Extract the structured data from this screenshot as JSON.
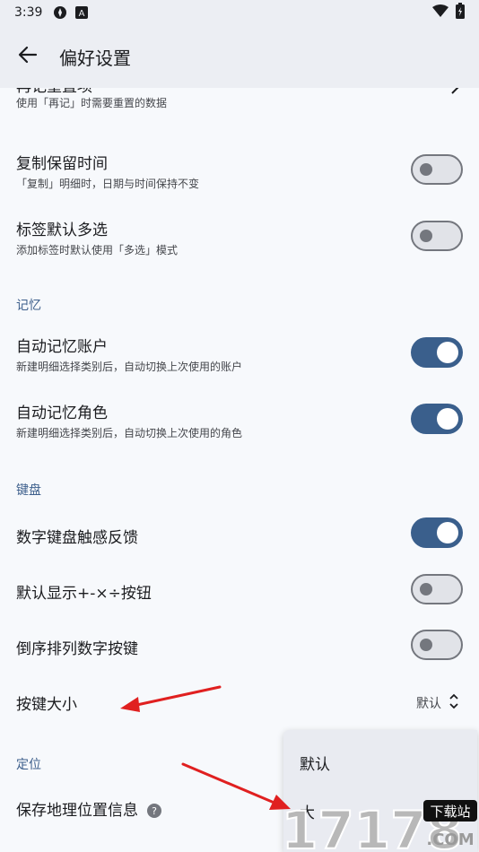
{
  "status_bar": {
    "time": "3:39"
  },
  "app_bar": {
    "title": "偏好设置"
  },
  "rows": {
    "reset_items": {
      "title": "再记重置项",
      "subtitle": "使用「再记」时需要重置的数据"
    },
    "copy_keep_time": {
      "title": "复制保留时间",
      "subtitle": "「复制」明细时，日期与时间保持不变",
      "on": false
    },
    "tag_multi": {
      "title": "标签默认多选",
      "subtitle": "添加标签时默认使用「多选」模式",
      "on": false
    },
    "auto_account": {
      "title": "自动记忆账户",
      "subtitle": "新建明细选择类别后，自动切换上次使用的账户",
      "on": true
    },
    "auto_role": {
      "title": "自动记忆角色",
      "subtitle": "新建明细选择类别后，自动切换上次使用的角色",
      "on": true
    },
    "keypad_haptic": {
      "title": "数字键盘触感反馈",
      "on": true
    },
    "show_ops": {
      "title": "默认显示+-×÷按钮",
      "on": false
    },
    "reverse_keys": {
      "title": "倒序排列数字按键",
      "on": false
    },
    "key_size": {
      "title": "按键大小",
      "value": "默认"
    },
    "save_location": {
      "title": "保存地理位置信息"
    }
  },
  "sections": {
    "memory": "记忆",
    "keyboard": "键盘",
    "location": "定位"
  },
  "dropdown": {
    "options": [
      "默认",
      "大"
    ]
  },
  "watermark": {
    "number": "17178",
    "site_label": "下载站",
    "domain": ".COM"
  },
  "colors": {
    "accent": "#3a5f8c",
    "arrow": "#e02020"
  }
}
